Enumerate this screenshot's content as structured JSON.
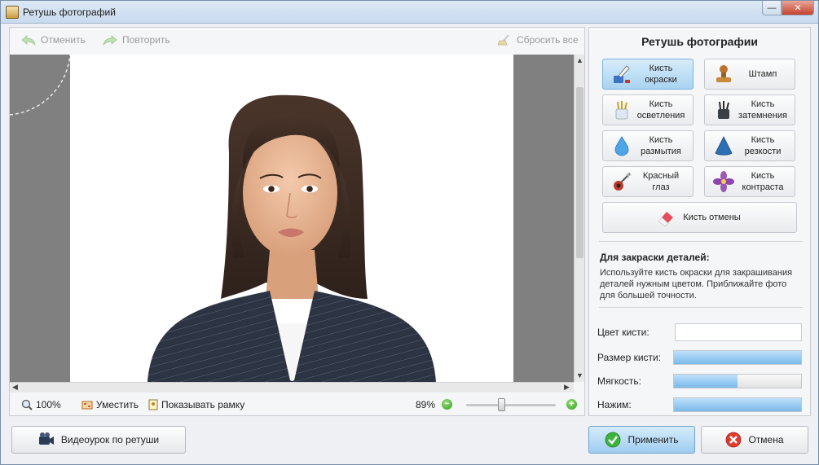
{
  "window": {
    "title": "Ретушь фотографий",
    "minimize": "—",
    "close": "✕"
  },
  "toolbar": {
    "undo": "Отменить",
    "redo": "Повторить",
    "reset": "Сбросить все"
  },
  "zoombar": {
    "zoom": "100%",
    "fit": "Уместить",
    "show_frame": "Показывать рамку",
    "zoom_percent": "89%",
    "zoom_minus": "−",
    "zoom_plus": "+",
    "zoom_level": 0.4
  },
  "right_panel": {
    "title": "Ретушь фотографии",
    "tools": [
      {
        "label": "Кисть\nокраски",
        "icon": "paint-brush-icon",
        "active": true
      },
      {
        "label": "Штамп",
        "icon": "stamp-icon",
        "active": false
      },
      {
        "label": "Кисть\nосветления",
        "icon": "lighten-brush-icon",
        "active": false
      },
      {
        "label": "Кисть\nзатемнения",
        "icon": "darken-brush-icon",
        "active": false
      },
      {
        "label": "Кисть\nразмытия",
        "icon": "blur-drop-icon",
        "active": false
      },
      {
        "label": "Кисть\nрезкости",
        "icon": "sharpen-cone-icon",
        "active": false
      },
      {
        "label": "Красный\nглаз",
        "icon": "red-eye-wand-icon",
        "active": false
      },
      {
        "label": "Кисть\nконтраста",
        "icon": "contrast-flower-icon",
        "active": false
      }
    ],
    "undo_brush": {
      "label": "Кисть отмены",
      "icon": "eraser-icon"
    },
    "hint": {
      "title": "Для закраски деталей:",
      "text": "Используйте кисть окраски для закрашивания деталей нужным цветом. Приближайте фото для большей точности."
    },
    "params": {
      "color_label": "Цвет кисти:",
      "color_value": "#ffffff",
      "size_label": "Размер кисти:",
      "size_level": 1.0,
      "softness_label": "Мягкость:",
      "softness_level": 0.5,
      "pressure_label": "Нажим:",
      "pressure_level": 1.0
    }
  },
  "buttons": {
    "video": "Видеоурок по ретуши",
    "apply": "Применить",
    "cancel": "Отмена"
  },
  "colors": {
    "accent": "#a9d3f1",
    "canvas_bg": "#808080",
    "hair": "#3a2a22",
    "jacket": "#2a3140"
  }
}
